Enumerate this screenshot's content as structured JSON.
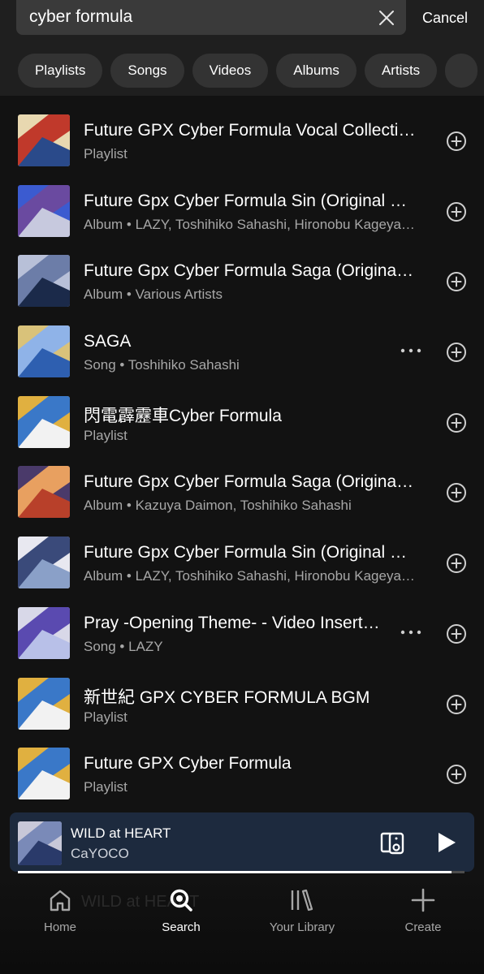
{
  "search": {
    "query": "cyber formula",
    "cancel_label": "Cancel"
  },
  "filters": [
    "Playlists",
    "Songs",
    "Videos",
    "Albums",
    "Artists"
  ],
  "results": [
    {
      "title": "Future GPX Cyber Formula Vocal Collection",
      "subtitle": "Playlist",
      "more": false,
      "art": [
        "#2a4a8a",
        "#c0392b",
        "#e8d8b0"
      ]
    },
    {
      "title": "Future Gpx Cyber Formula Sin (Original Soundtrack)",
      "subtitle": "Album • LAZY, Toshihiko Sahashi, Hironobu Kageyama",
      "more": false,
      "art": [
        "#c7c9de",
        "#6a4aa0",
        "#3b5bd0"
      ]
    },
    {
      "title": "Future Gpx Cyber Formula Saga (Original Soundtrack)",
      "subtitle": "Album • Various Artists",
      "more": false,
      "art": [
        "#1b2a4a",
        "#6c7da8",
        "#b8c0d8"
      ]
    },
    {
      "title": "SAGA",
      "subtitle": "Song • Toshihiko Sahashi",
      "more": true,
      "art": [
        "#2e5fb0",
        "#8fb3e8",
        "#d9c27a"
      ]
    },
    {
      "title": "閃電霹靂車Cyber Formula",
      "subtitle": "Playlist",
      "more": false,
      "art": [
        "#f2f2f2",
        "#3a78c8",
        "#e0b040"
      ]
    },
    {
      "title": "Future Gpx Cyber Formula Saga (Original Soundtrack)",
      "subtitle": "Album • Kazuya Daimon, Toshihiko Sahashi",
      "more": false,
      "art": [
        "#b8402a",
        "#e8a060",
        "#4a3a6a"
      ]
    },
    {
      "title": "Future Gpx Cyber Formula Sin (Original Soundtrack)",
      "subtitle": "Album • LAZY, Toshihiko Sahashi, Hironobu Kageyama",
      "more": false,
      "art": [
        "#8aa0c8",
        "#3a4a7a",
        "#e8e8f0"
      ]
    },
    {
      "title": "Pray -Opening Theme- - Video Insert Version",
      "subtitle": "Song • LAZY",
      "more": true,
      "art": [
        "#b8c0e8",
        "#5a4ab0",
        "#d8d8e8"
      ]
    },
    {
      "title": "新世紀 GPX CYBER FORMULA BGM",
      "subtitle": "Playlist",
      "more": false,
      "art": [
        "#f2f2f2",
        "#3a78c8",
        "#e0b040"
      ]
    },
    {
      "title": "Future GPX Cyber Formula",
      "subtitle": "Playlist",
      "more": false,
      "art": [
        "#f2f2f2",
        "#3a78c8",
        "#e0b040"
      ]
    }
  ],
  "now_playing": {
    "title": "WILD at HEART",
    "artist": "CaYOCO",
    "progress": 0.97,
    "art": [
      "#2a3a6a",
      "#7a8ab8",
      "#c8c8d8"
    ]
  },
  "nav": {
    "ghost_text": "WILD at HEART",
    "items": [
      {
        "label": "Home",
        "icon": "home-icon",
        "active": false
      },
      {
        "label": "Search",
        "icon": "search-icon",
        "active": true
      },
      {
        "label": "Your Library",
        "icon": "library-icon",
        "active": false
      },
      {
        "label": "Create",
        "icon": "plus-icon",
        "active": false
      }
    ]
  },
  "colors": {
    "background": "#121212",
    "chip": "#333333",
    "player": "#1d2a3e",
    "secondary_text": "#a7a7a7"
  }
}
